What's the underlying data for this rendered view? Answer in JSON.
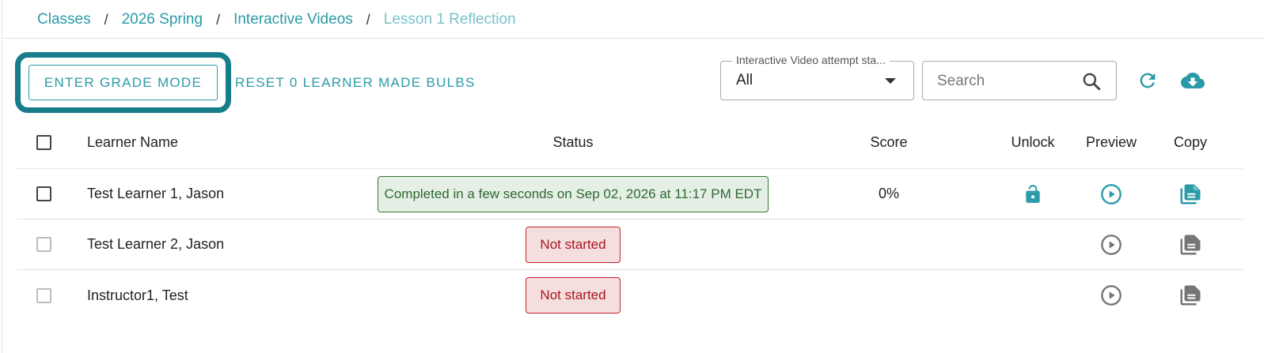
{
  "breadcrumb": {
    "items": [
      "Classes",
      "2026 Spring",
      "Interactive Videos"
    ],
    "current": "Lesson 1 Reflection",
    "separator": "/"
  },
  "toolbar": {
    "grade_mode_label": "ENTER GRADE MODE",
    "reset_label": "RESET 0 LEARNER MADE BULBS",
    "filter_label": "Interactive Video attempt sta...",
    "filter_value": "All",
    "search_placeholder": "Search",
    "refresh_icon": "refresh-icon",
    "download_icon": "cloud-download-icon"
  },
  "table": {
    "headers": {
      "name": "Learner Name",
      "status": "Status",
      "score": "Score",
      "unlock": "Unlock",
      "preview": "Preview",
      "copy": "Copy"
    },
    "rows": [
      {
        "name": "Test Learner 1, Jason",
        "status": "Completed in a few seconds on Sep 02, 2026 at 11:17 PM EDT",
        "status_type": "complete",
        "score": "0%",
        "unlock_icon": "lock-open-icon"
      },
      {
        "name": "Test Learner 2, Jason",
        "status": "Not started",
        "status_type": "not-started",
        "score": ""
      },
      {
        "name": "Instructor1, Test",
        "status": "Not started",
        "status_type": "not-started",
        "score": ""
      }
    ]
  },
  "colors": {
    "accent": "#2a9aa8",
    "focus_ring": "#177d8a",
    "complete_bg": "#e6efe6",
    "complete_text": "#2d6a31",
    "notstarted_bg": "#f5dede",
    "notstarted_text": "#a8181f",
    "icon_disabled": "#757575"
  }
}
